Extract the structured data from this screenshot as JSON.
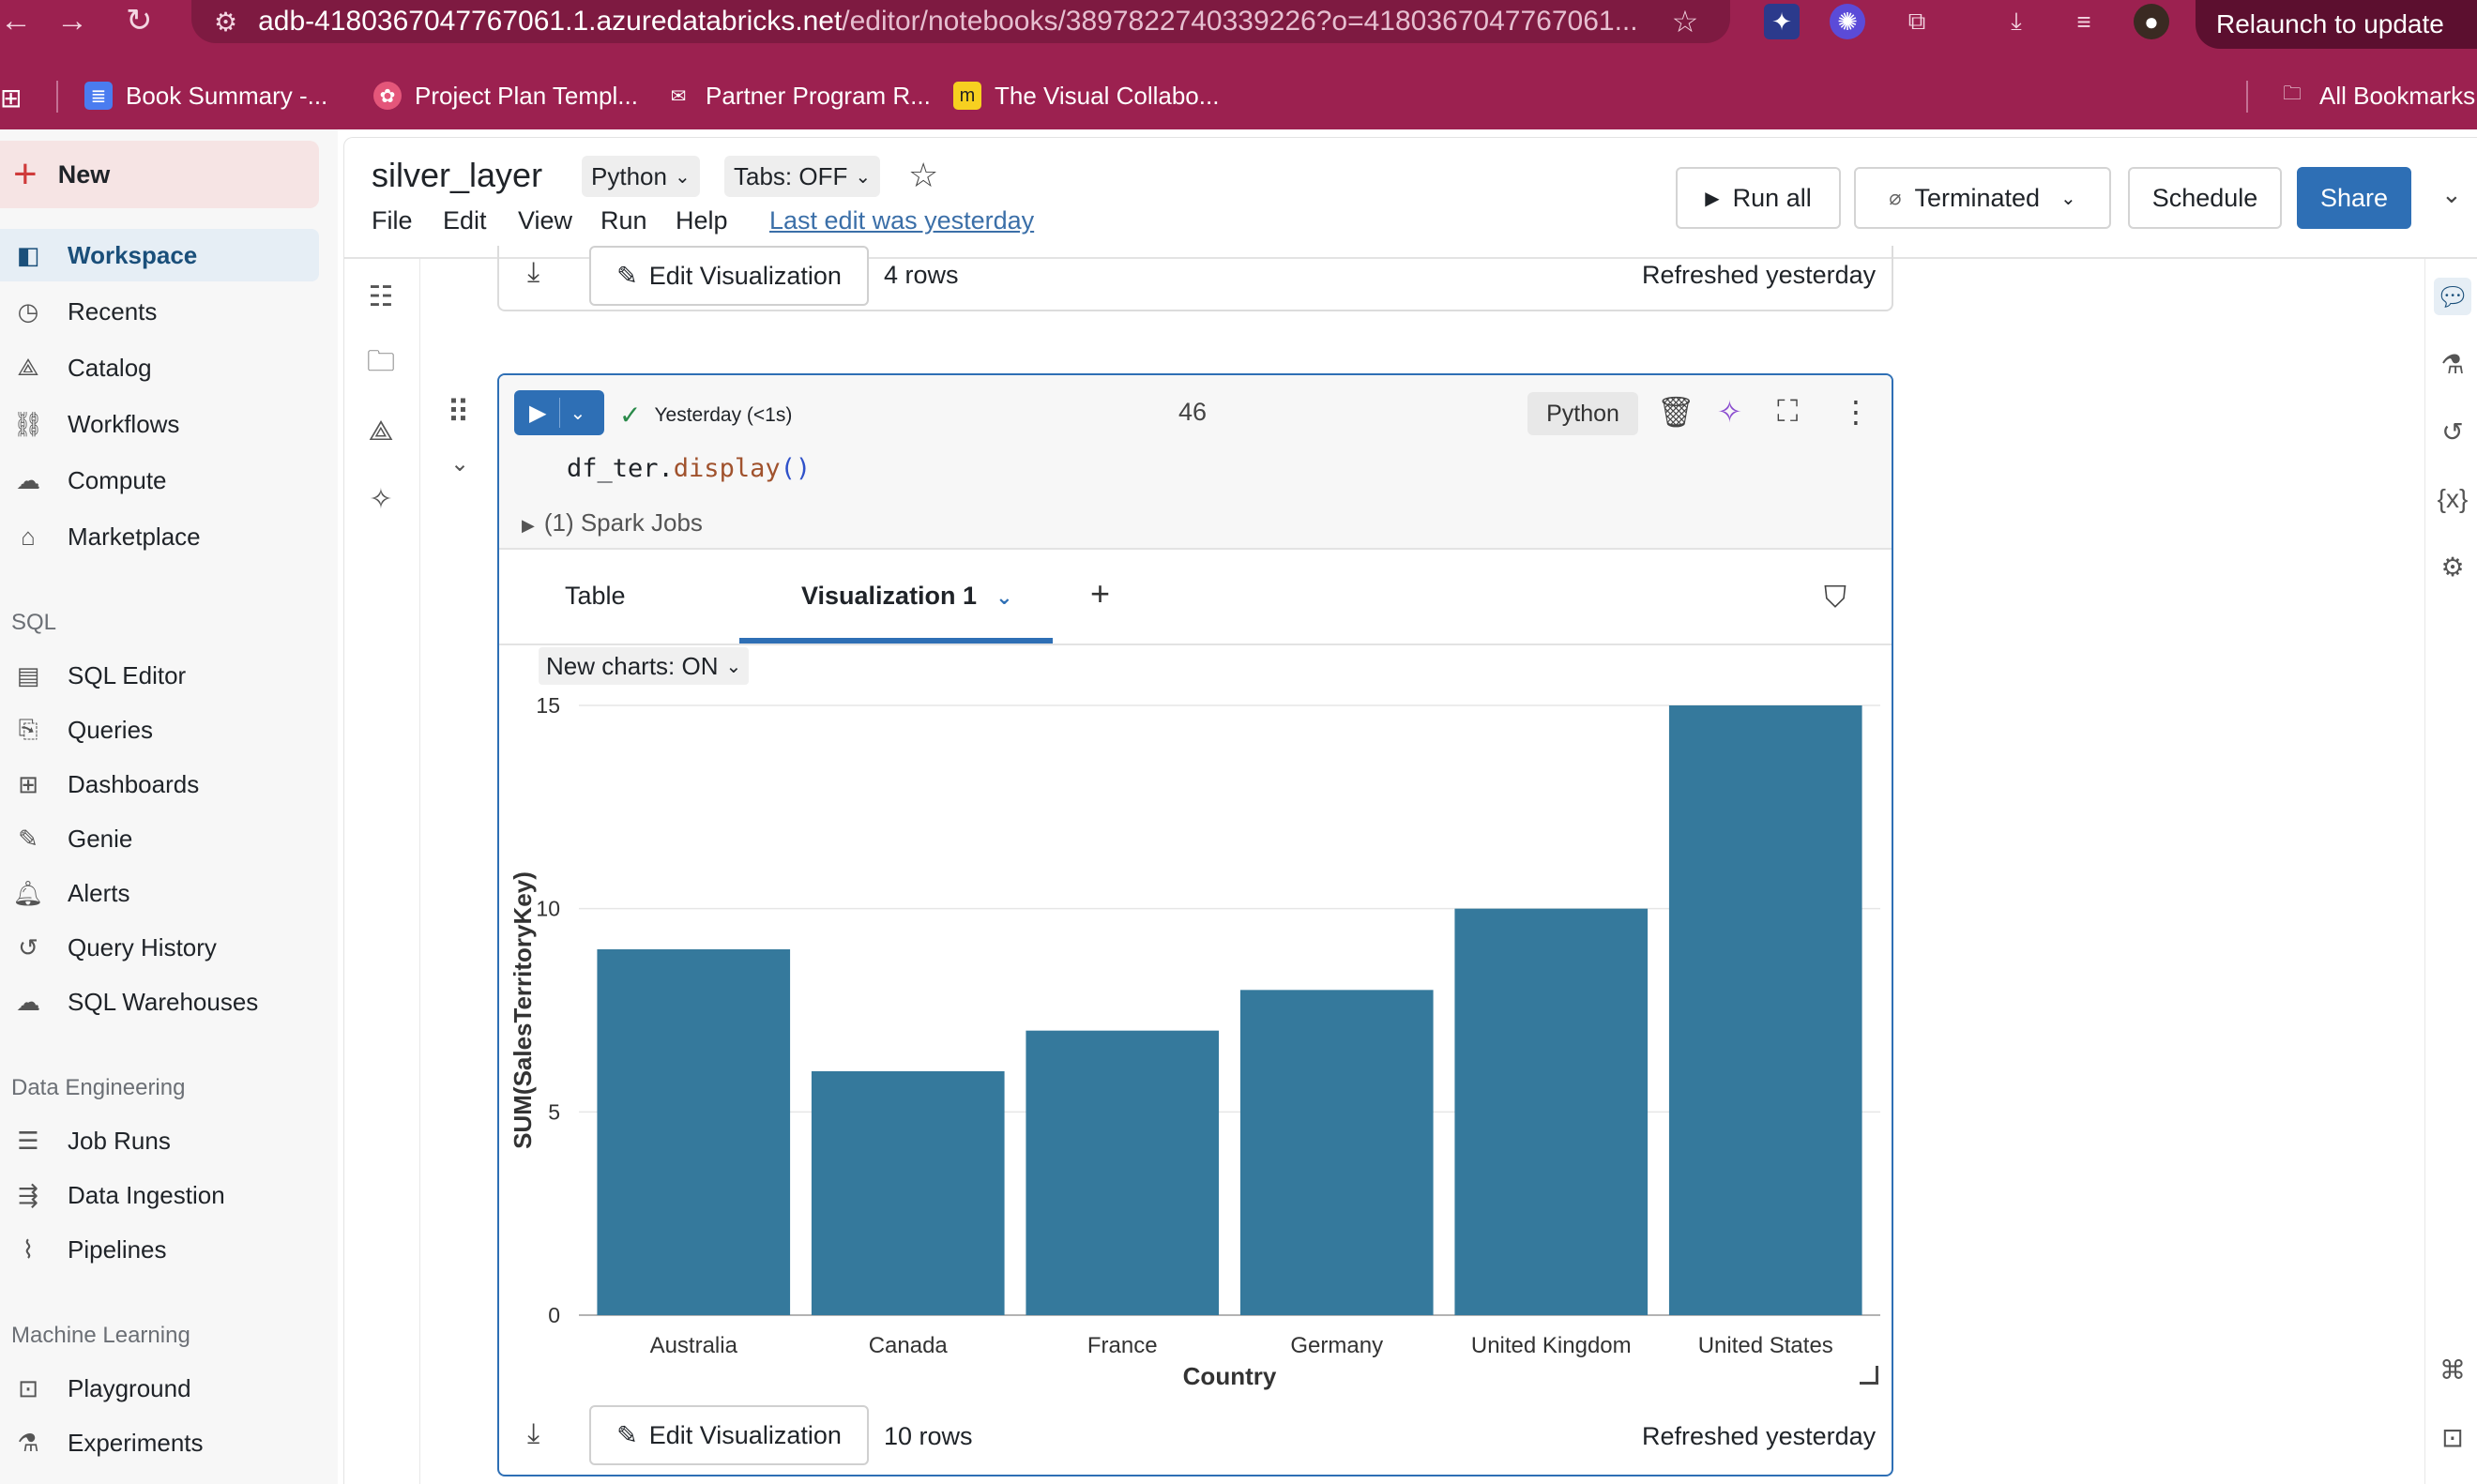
{
  "browser": {
    "url_host": "adb-4180367047767061.1.azuredatabricks.net",
    "url_path": "/editor/notebooks/3897822740339226?o=4180367047767061...",
    "relaunch_label": "Relaunch to update",
    "bookmarks": [
      {
        "label": "Book Summary -...",
        "icon": "doc-icon",
        "color": "#4a7cf0"
      },
      {
        "label": "Project Plan Templ...",
        "icon": "flower-icon",
        "color": "#e4567a"
      },
      {
        "label": "Partner Program R...",
        "icon": "envelope-icon",
        "color": "#ffffff"
      },
      {
        "label": "The Visual Collabo...",
        "icon": "miro-icon",
        "color": "#f7d020"
      }
    ],
    "all_bookmarks_label": "All Bookmarks"
  },
  "sidebar": {
    "new_label": "New",
    "items_top": [
      {
        "label": "Workspace",
        "icon": "workspace-icon",
        "active": true
      },
      {
        "label": "Recents",
        "icon": "clock-icon"
      },
      {
        "label": "Catalog",
        "icon": "catalog-icon"
      },
      {
        "label": "Workflows",
        "icon": "workflows-icon"
      },
      {
        "label": "Compute",
        "icon": "cloud-icon"
      },
      {
        "label": "Marketplace",
        "icon": "store-icon"
      }
    ],
    "sql_section": "SQL",
    "sql_items": [
      {
        "label": "SQL Editor",
        "icon": "sql-editor-icon"
      },
      {
        "label": "Queries",
        "icon": "query-icon"
      },
      {
        "label": "Dashboards",
        "icon": "dashboard-icon"
      },
      {
        "label": "Genie",
        "icon": "genie-icon"
      },
      {
        "label": "Alerts",
        "icon": "bell-icon"
      },
      {
        "label": "Query History",
        "icon": "history-icon"
      },
      {
        "label": "SQL Warehouses",
        "icon": "warehouse-icon"
      }
    ],
    "de_section": "Data Engineering",
    "de_items": [
      {
        "label": "Job Runs",
        "icon": "job-runs-icon"
      },
      {
        "label": "Data Ingestion",
        "icon": "ingest-icon"
      },
      {
        "label": "Pipelines",
        "icon": "pipeline-icon"
      }
    ],
    "ml_section": "Machine Learning",
    "ml_items": [
      {
        "label": "Playground",
        "icon": "robot-icon"
      },
      {
        "label": "Experiments",
        "icon": "flask-icon"
      }
    ]
  },
  "notebook": {
    "title": "silver_layer",
    "language": "Python",
    "tabs": "Tabs: OFF",
    "menu": [
      "File",
      "Edit",
      "View",
      "Run",
      "Help"
    ],
    "last_edit": "Last edit was yesterday",
    "run_all": "Run all",
    "cluster": "Terminated",
    "schedule": "Schedule",
    "share": "Share"
  },
  "prev_cell": {
    "edit_viz": "Edit Visualization",
    "rows": "4 rows",
    "refreshed": "Refreshed yesterday"
  },
  "cell": {
    "status": "Yesterday (<1s)",
    "number": "46",
    "language": "Python",
    "code_obj": "df_ter.",
    "code_fn": "display",
    "code_paren": "()",
    "spark_jobs": "(1) Spark Jobs",
    "tab_table": "Table",
    "tab_viz": "Visualization 1",
    "new_charts": "New charts: ON",
    "edit_viz": "Edit Visualization",
    "rows": "10 rows",
    "refreshed": "Refreshed yesterday"
  },
  "chart_data": {
    "type": "bar",
    "categories": [
      "Australia",
      "Canada",
      "France",
      "Germany",
      "United Kingdom",
      "United States"
    ],
    "values": [
      9,
      6,
      7,
      8,
      10,
      15
    ],
    "xlabel": "Country",
    "ylabel": "SUM(SalesTerritoryKey)",
    "ylim": [
      0,
      15
    ],
    "yticks": [
      0,
      5,
      10,
      15
    ],
    "grid": true,
    "bar_color": "#35799c"
  }
}
